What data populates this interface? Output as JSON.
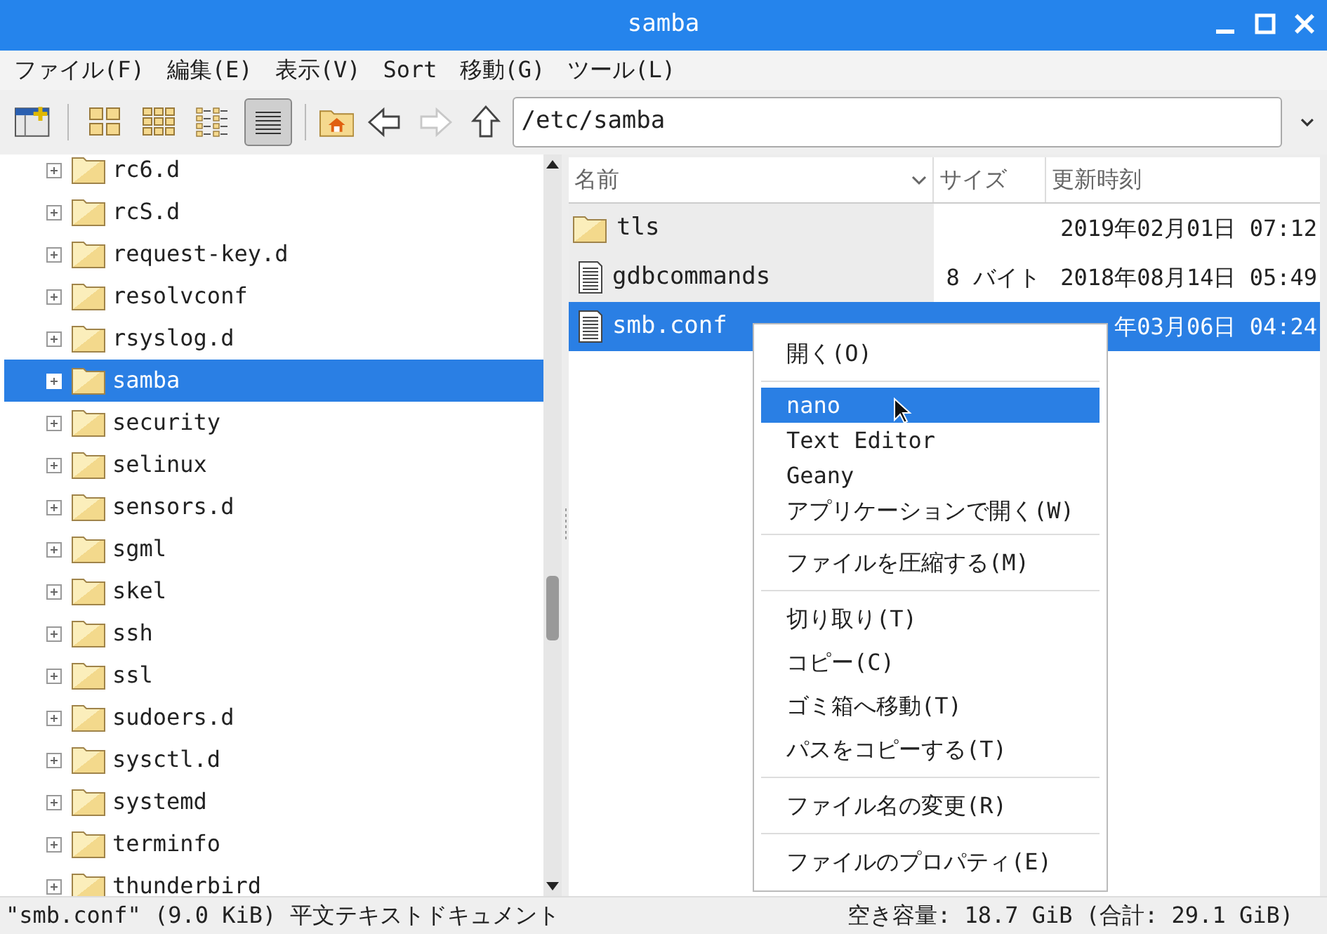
{
  "window": {
    "title": "samba"
  },
  "menubar": [
    "ファイル(F)",
    "編集(E)",
    "表示(V)",
    "Sort",
    "移動(G)",
    "ツール(L)"
  ],
  "toolbar": {
    "view_buttons": [
      {
        "kind": "icons",
        "selected": false
      },
      {
        "kind": "thumbnails",
        "selected": false
      },
      {
        "kind": "compact",
        "selected": false
      },
      {
        "kind": "detailed",
        "selected": true
      }
    ],
    "nav_buttons": [
      {
        "kind": "back",
        "disabled": false
      },
      {
        "kind": "forward",
        "disabled": true
      },
      {
        "kind": "up",
        "disabled": false
      }
    ],
    "path": "/etc/samba"
  },
  "tree": {
    "items": [
      {
        "label": "rc6.d",
        "selected": false
      },
      {
        "label": "rcS.d",
        "selected": false
      },
      {
        "label": "request-key.d",
        "selected": false
      },
      {
        "label": "resolvconf",
        "selected": false
      },
      {
        "label": "rsyslog.d",
        "selected": false
      },
      {
        "label": "samba",
        "selected": true
      },
      {
        "label": "security",
        "selected": false
      },
      {
        "label": "selinux",
        "selected": false
      },
      {
        "label": "sensors.d",
        "selected": false
      },
      {
        "label": "sgml",
        "selected": false
      },
      {
        "label": "skel",
        "selected": false
      },
      {
        "label": "ssh",
        "selected": false
      },
      {
        "label": "ssl",
        "selected": false
      },
      {
        "label": "sudoers.d",
        "selected": false
      },
      {
        "label": "sysctl.d",
        "selected": false
      },
      {
        "label": "systemd",
        "selected": false
      },
      {
        "label": "terminfo",
        "selected": false
      },
      {
        "label": "thunderbird",
        "selected": false
      }
    ]
  },
  "file_list": {
    "columns": [
      "名前",
      "サイズ",
      "更新時刻"
    ],
    "rows": [
      {
        "kind": "folder",
        "name": "tls",
        "modified": "2019年02月01日 07:12",
        "selected": false
      },
      {
        "kind": "file",
        "name": "gdbcommands",
        "size": "8 バイト",
        "modified": "2018年08月14日 05:49",
        "selected": false
      },
      {
        "kind": "file",
        "name": "smb.conf",
        "modified": "年03月06日 04:24",
        "selected": true
      }
    ]
  },
  "context_menu": {
    "groups": [
      [
        {
          "kind": "action",
          "label": "開く(O)",
          "highlighted": false
        }
      ],
      [
        {
          "kind": "app",
          "label": "nano",
          "highlighted": true
        },
        {
          "kind": "app",
          "label": "Text Editor",
          "highlighted": false
        },
        {
          "kind": "app",
          "label": "Geany",
          "highlighted": false
        },
        {
          "kind": "app",
          "label": "アプリケーションで開く(W)",
          "highlighted": false
        }
      ],
      [
        {
          "kind": "action",
          "label": "ファイルを圧縮する(M)",
          "highlighted": false
        }
      ],
      [
        {
          "kind": "action",
          "label": "切り取り(T)",
          "highlighted": false
        },
        {
          "kind": "action",
          "label": "コピー(C)",
          "highlighted": false
        },
        {
          "kind": "action",
          "label": "ゴミ箱へ移動(T)",
          "highlighted": false
        },
        {
          "kind": "action",
          "label": "パスをコピーする(T)",
          "highlighted": false
        }
      ],
      [
        {
          "kind": "action",
          "label": "ファイル名の変更(R)",
          "highlighted": false
        }
      ],
      [
        {
          "kind": "action",
          "label": "ファイルのプロパティ(E)",
          "highlighted": false
        }
      ]
    ]
  },
  "status_bar": {
    "left": "\"smb.conf\" (9.0 KiB) 平文テキストドキュメント",
    "right": "空き容量: 18.7 GiB (合計: 29.1 GiB)"
  }
}
